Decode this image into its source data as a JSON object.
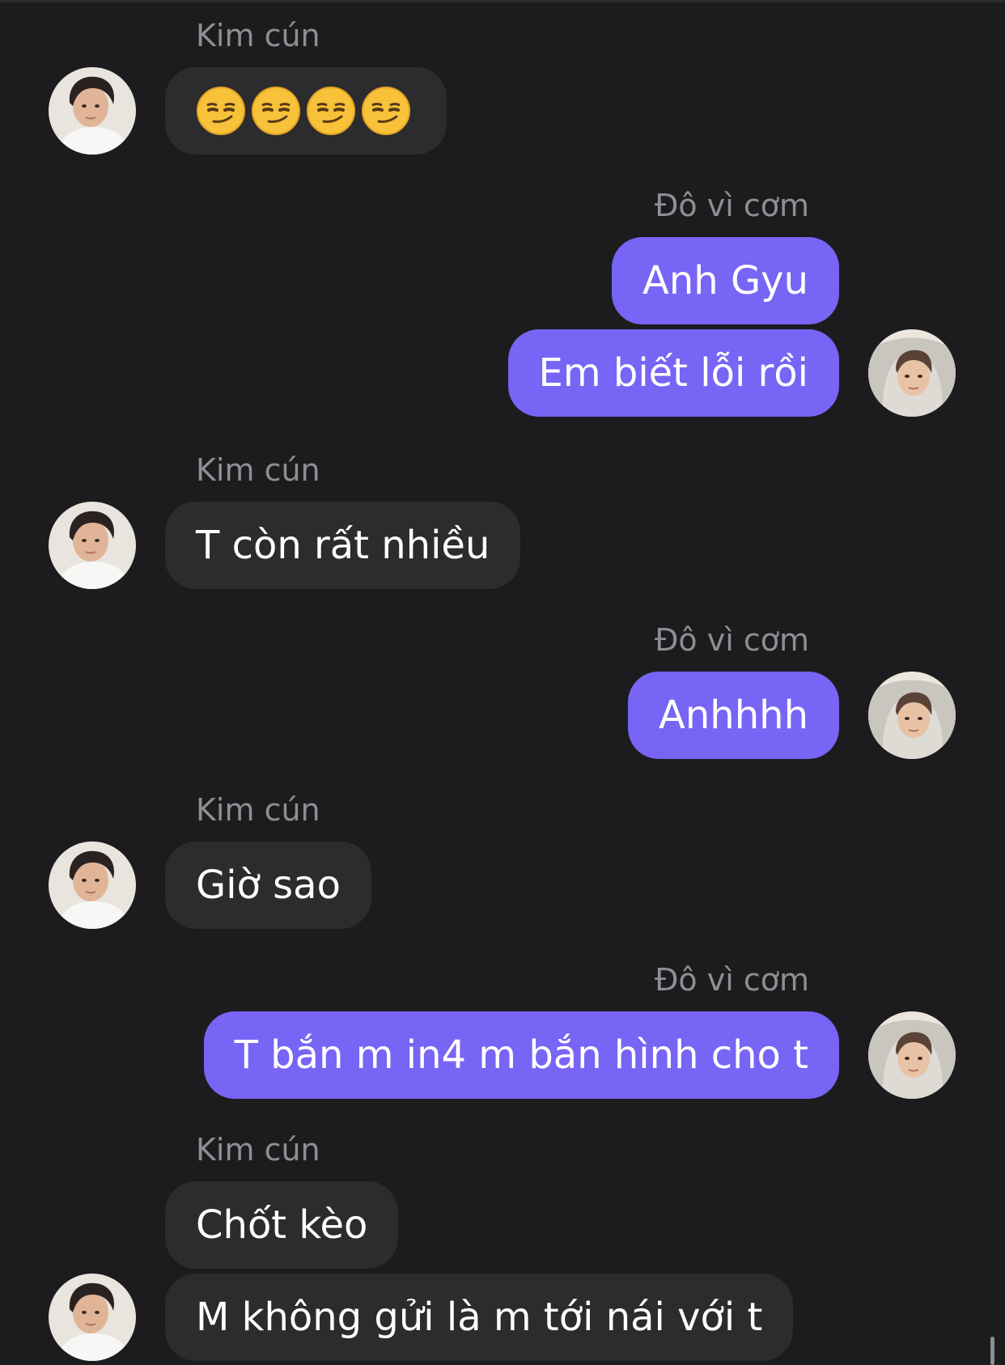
{
  "colors": {
    "background": "#1c1c1e",
    "incoming_bubble": "#2c2c2e",
    "outgoing_bubble": "#7864f5",
    "sender_name": "#8e8e93"
  },
  "messages": [
    {
      "sender": "Kim cún",
      "side": "left",
      "emoji": [
        "smirking-face",
        "smirking-face",
        "smirking-face",
        "smirking-face"
      ],
      "text": "😏😏😏😏"
    },
    {
      "sender": "Đô vì cơm",
      "side": "right",
      "text": "Anh Gyu"
    },
    {
      "side": "right",
      "text": "Em biết lỗi rồi"
    },
    {
      "sender": "Kim cún",
      "side": "left",
      "text": "T còn rất nhiều"
    },
    {
      "sender": "Đô vì cơm",
      "side": "right",
      "text": "Anhhhh"
    },
    {
      "sender": "Kim cún",
      "side": "left",
      "text": "Giờ sao"
    },
    {
      "sender": "Đô vì cơm",
      "side": "right",
      "text": "T bắn m in4 m bắn hình cho t"
    },
    {
      "sender": "Kim cún",
      "side": "left",
      "text": "Chốt kèo"
    },
    {
      "side": "left",
      "text": "M không gửi là m tới nái với t"
    }
  ],
  "avatars": {
    "kim_cun": "avatar-kim-cun",
    "do_vi_com": "avatar-do-vi-com"
  }
}
